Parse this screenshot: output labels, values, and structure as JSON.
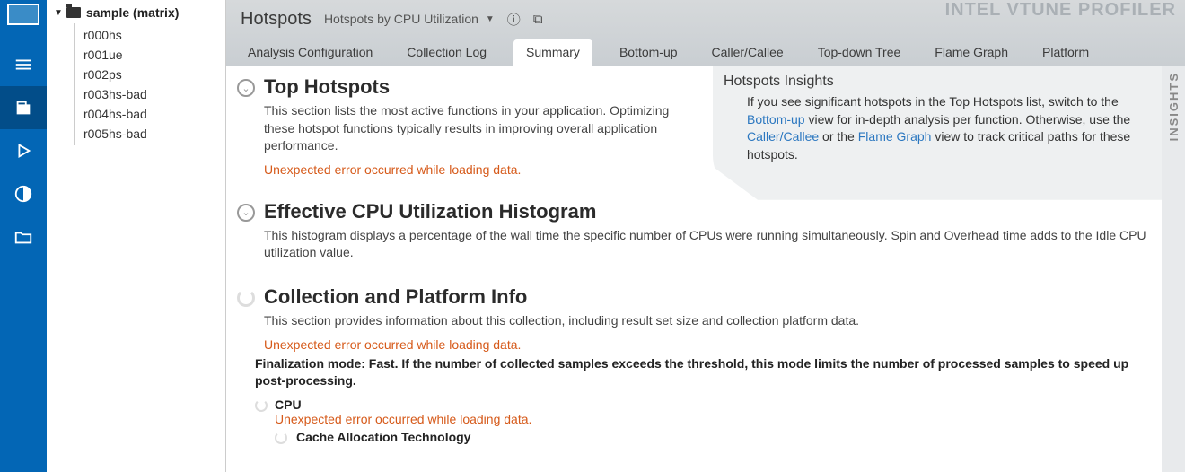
{
  "brand": "INTEL VTUNE PROFILER",
  "left_nav": {
    "items": [
      "menu",
      "project",
      "play",
      "compare",
      "open"
    ]
  },
  "tree": {
    "root": "sample (matrix)",
    "children": [
      "r000hs",
      "r001ue",
      "r002ps",
      "r003hs-bad",
      "r004hs-bad",
      "r005hs-bad"
    ]
  },
  "header": {
    "title": "Hotspots",
    "subtitle": "Hotspots by CPU Utilization"
  },
  "tabs": [
    "Analysis Configuration",
    "Collection Log",
    "Summary",
    "Bottom-up",
    "Caller/Callee",
    "Top-down Tree",
    "Flame Graph",
    "Platform"
  ],
  "active_tab": "Summary",
  "insights_rail": "INSIGHTS",
  "insights": {
    "title": "Hotspots Insights",
    "pre1": "If you see significant hotspots in the Top Hotspots list, switch to the ",
    "link1": "Bottom-up",
    "mid1": " view for in-depth analysis per function. Otherwise, use the ",
    "link2": "Caller/Callee",
    "mid2": " or the ",
    "link3": "Flame Graph",
    "post": " view to track critical paths for these hotspots."
  },
  "sections": {
    "top": {
      "title": "Top Hotspots",
      "desc": "This section lists the most active functions in your application. Optimizing these hotspot functions typically results in improving overall application performance.",
      "error": "Unexpected error occurred while loading data."
    },
    "hist": {
      "title": "Effective CPU Utilization Histogram",
      "desc": "This histogram displays a percentage of the wall time the specific number of CPUs were running simultaneously. Spin and Overhead time adds to the Idle CPU utilization value."
    },
    "info": {
      "title": "Collection and Platform Info",
      "desc": "This section provides information about this collection, including result set size and collection platform data.",
      "error": "Unexpected error occurred while loading data.",
      "finalization": "Finalization mode: Fast. If the number of collected samples exceeds the threshold, this mode limits the number of processed samples to speed up post-processing.",
      "cpu_label": "CPU",
      "cpu_error": "Unexpected error occurred while loading data.",
      "cat_label": "Cache Allocation Technology"
    }
  }
}
